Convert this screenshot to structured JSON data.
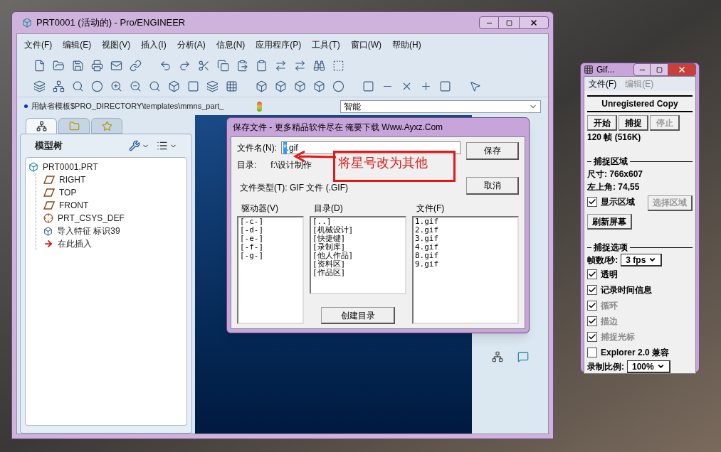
{
  "proe_window": {
    "title": "PRT0001 (活动的) - Pro/ENGINEER",
    "menu": [
      "文件(F)",
      "编辑(E)",
      "视图(V)",
      "插入(I)",
      "分析(A)",
      "信息(N)",
      "应用程序(P)",
      "工具(T)",
      "窗口(W)",
      "帮助(H)"
    ],
    "message": "用缺省模板$PRO_DIRECTORY\\templates\\mmns_part_",
    "filter": "智能",
    "nav_tabs": [
      {
        "kind": "tree",
        "selected": true
      },
      {
        "kind": "folders",
        "selected": false
      },
      {
        "kind": "favorites",
        "selected": false
      }
    ],
    "model_tree": {
      "title": "模型树",
      "items": [
        {
          "label": "PRT0001.PRT",
          "kind": "part",
          "children": [
            {
              "label": "RIGHT",
              "kind": "plane"
            },
            {
              "label": "TOP",
              "kind": "plane"
            },
            {
              "label": "FRONT",
              "kind": "plane"
            },
            {
              "label": "PRT_CSYS_DEF",
              "kind": "csys"
            },
            {
              "label": "导入特征 标识39",
              "kind": "import"
            },
            {
              "label": "在此插入",
              "kind": "insert"
            }
          ]
        }
      ]
    }
  },
  "save_dialog": {
    "title": "保存文件 - 更多精品软件尽在 俺要下载 Www.Ayxz.Com",
    "filename_label": "文件名(N):",
    "filename": {
      "selected_part": "*",
      "rest": ".gif"
    },
    "directory_label": "目录:",
    "directory": "f:\\设计制作",
    "file_type": "文件类型(T): GIF 文件 (.GIF)",
    "save_button": "保存",
    "cancel_button": "取消",
    "lists": [
      {
        "label": "驱动器(V)",
        "items": [
          "[-c-]",
          "[-d-]",
          "[-e-]",
          "[-f-]",
          "[-g-]"
        ]
      },
      {
        "label": "目录(D)",
        "items": [
          "[..]",
          "[机械设计]",
          "[快捷键]",
          "[录制库]",
          "[他人作品]",
          "[资料区]",
          "[作品区]"
        ]
      },
      {
        "label": "文件(F)",
        "items": [
          "1.gif",
          "2.gif",
          "3.gif",
          "4.gif",
          "8.gif",
          "9.gif"
        ]
      }
    ],
    "create_dir_button": "创建目录"
  },
  "annotation": {
    "text": "将星号改为其他"
  },
  "gif_window": {
    "title": "Gif...",
    "menu": [
      {
        "label": "文件(F)",
        "disabled": false
      },
      {
        "label": "编辑(E)",
        "disabled": true
      }
    ],
    "banner": "Unregistered Copy",
    "buttons": [
      {
        "label": "开始",
        "disabled": false
      },
      {
        "label": "捕捉",
        "disabled": false
      },
      {
        "label": "停止",
        "disabled": true
      }
    ],
    "frames": "120 帧 (516K)",
    "capture_area": {
      "heading": "捕捉区域",
      "size": "尺寸: 766x607",
      "top_left": "左上角: 74,55",
      "show_area": {
        "label": "显示区域",
        "checked": true
      },
      "select_area": {
        "label": "选择区域",
        "disabled": true
      },
      "refresh": "刷新屏幕"
    },
    "options": {
      "heading": "捕捉选项",
      "fps_label": "帧数/秒:",
      "fps": "3 fps",
      "checks": [
        {
          "label": "透明",
          "checked": true,
          "disabled": false
        },
        {
          "label": "记录时间信息",
          "checked": true,
          "disabled": false
        },
        {
          "label": "循环",
          "checked": true,
          "disabled": true
        },
        {
          "label": "描边",
          "checked": true,
          "disabled": true
        },
        {
          "label": "捕捉光标",
          "checked": true,
          "disabled": true
        },
        {
          "label": "Explorer 2.0 兼容",
          "checked": false,
          "disabled": false
        }
      ],
      "ratio_label": "录制比例:",
      "ratio": "100%"
    }
  }
}
